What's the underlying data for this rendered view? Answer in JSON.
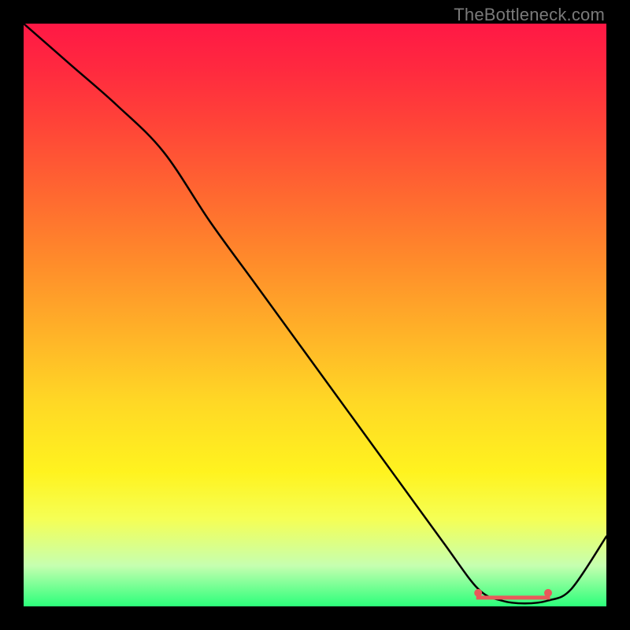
{
  "watermark": "TheBottleneck.com",
  "chart_data": {
    "type": "line",
    "title": "",
    "xlabel": "",
    "ylabel": "",
    "xlim": [
      0,
      100
    ],
    "ylim": [
      0,
      100
    ],
    "grid": false,
    "legend": false,
    "series": [
      {
        "name": "curve",
        "x": [
          0,
          8,
          16,
          24,
          32,
          40,
          48,
          56,
          64,
          72,
          78,
          82,
          86,
          90,
          94,
          100
        ],
        "values": [
          100,
          93,
          86,
          78,
          66,
          55,
          44,
          33,
          22,
          11,
          3,
          1,
          0.5,
          1,
          3,
          12
        ]
      }
    ],
    "annotation": {
      "optimal_range_x": [
        78,
        90
      ],
      "optimal_range_y": 1.5
    },
    "background_gradient": {
      "stops": [
        {
          "pos": 0.0,
          "color": "#ff1845"
        },
        {
          "pos": 0.3,
          "color": "#ff6a30"
        },
        {
          "pos": 0.55,
          "color": "#ffb528"
        },
        {
          "pos": 0.78,
          "color": "#fff31f"
        },
        {
          "pos": 0.93,
          "color": "#c6ffb0"
        },
        {
          "pos": 1.0,
          "color": "#2bff7a"
        }
      ]
    }
  }
}
